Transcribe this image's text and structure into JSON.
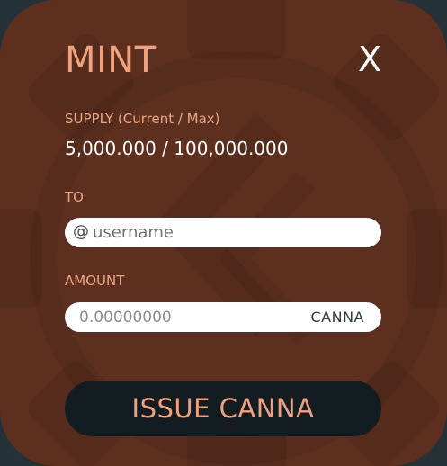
{
  "modal": {
    "title": "MINT",
    "close_label": "X",
    "supply": {
      "label": "SUPPLY (Current / Max)",
      "value": "5,000.000 / 100,000.000"
    },
    "to": {
      "label": "TO",
      "prefix": "@",
      "placeholder": "username",
      "value": ""
    },
    "amount": {
      "label": "AMOUNT",
      "placeholder": "0.00000000",
      "value": "",
      "unit": "CANNA"
    },
    "submit_label": "ISSUE CANNA"
  },
  "colors": {
    "modal_background": "#5c2f1e",
    "accent": "#f0a27f",
    "button_background": "#131c21",
    "backdrop": "#243238"
  },
  "icons": {
    "close": "close-icon",
    "background_watermark": "gear-watermark-icon"
  }
}
